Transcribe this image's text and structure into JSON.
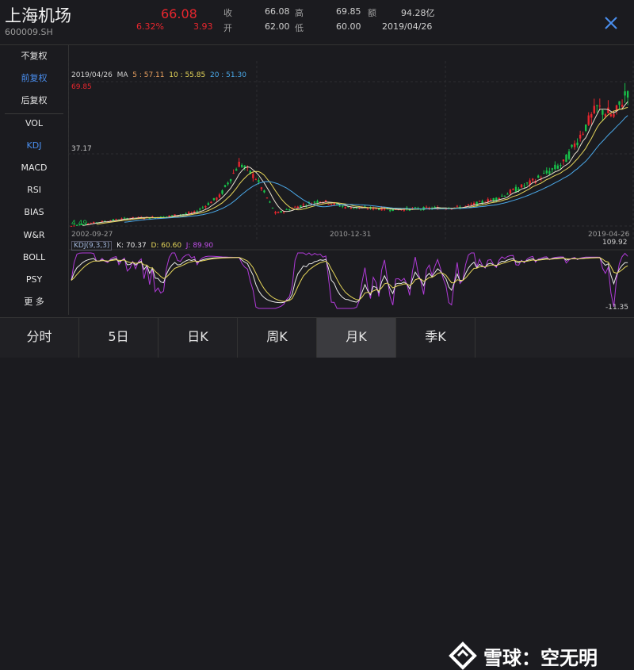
{
  "header": {
    "stock_name": "上海机场",
    "stock_code": "600009.SH",
    "price": "66.08",
    "change_pct": "6.32%",
    "change_value": "3.93",
    "quotes": [
      {
        "label": "收",
        "value": "66.08"
      },
      {
        "label": "高",
        "value": "69.85"
      },
      {
        "label": "额",
        "value": "94.28亿"
      },
      {
        "label": "开",
        "value": "62.00"
      },
      {
        "label": "低",
        "value": "60.00"
      },
      {
        "label": "date",
        "value": "2019/04/26"
      }
    ]
  },
  "sidebar": {
    "items": [
      {
        "label": "不复权",
        "active": false
      },
      {
        "label": "前复权",
        "active": true
      },
      {
        "label": "后复权",
        "active": false
      },
      {
        "label": "VOL",
        "active": false
      },
      {
        "label": "KDJ",
        "active": true
      },
      {
        "label": "MACD",
        "active": false
      },
      {
        "label": "RSI",
        "active": false
      },
      {
        "label": "BIAS",
        "active": false
      },
      {
        "label": "W&R",
        "active": false
      },
      {
        "label": "BOLL",
        "active": false
      },
      {
        "label": "PSY",
        "active": false
      },
      {
        "label": "更 多",
        "active": false
      }
    ]
  },
  "chart": {
    "ma_date": "2019/04/26",
    "ma_label": "MA",
    "ma5_label": "5 : 57.11",
    "ma10_label": "10 : 55.85",
    "ma20_label": "20 : 51.30",
    "y_max_label": "69.85",
    "y_mid_label": "37.17",
    "y_min_label": "4.49",
    "x_start": "2002-09-27",
    "x_mid": "2010-12-31",
    "x_end": "2019-04-26",
    "kdj_title": "KDJ(9,3,3)",
    "kdj_k": "K: 70.37",
    "kdj_d": "D: 60.60",
    "kdj_j": "J: 89.90",
    "kdj_max": "109.92",
    "kdj_min": "-11.35",
    "colors": {
      "up": "#e8262e",
      "down": "#18c24a",
      "ma5": "#e8e0d0",
      "ma10": "#e6d65a",
      "ma20": "#4aa8e8",
      "k": "#e8e8e8",
      "d": "#e6d65a",
      "j": "#b03ad8",
      "accent": "#4a8ff0"
    }
  },
  "chart_data": {
    "type": "candlestick",
    "title": "",
    "x_range": [
      "2002-09-27",
      "2019-04-26"
    ],
    "y_range": [
      4.49,
      69.85
    ],
    "series": [
      {
        "name": "MA5",
        "last": 57.11
      },
      {
        "name": "MA10",
        "last": 55.85
      },
      {
        "name": "MA20",
        "last": 51.3
      }
    ],
    "price_anchors": [
      {
        "x": "2002-09-27",
        "y": 4.49
      },
      {
        "x": "2003-06",
        "y": 6.0
      },
      {
        "x": "2004-06",
        "y": 8.0
      },
      {
        "x": "2005-06",
        "y": 8.5
      },
      {
        "x": "2006-06",
        "y": 10.5
      },
      {
        "x": "2007-03",
        "y": 18.0
      },
      {
        "x": "2007-10",
        "y": 33.0
      },
      {
        "x": "2008-04",
        "y": 26.0
      },
      {
        "x": "2008-11",
        "y": 10.0
      },
      {
        "x": "2009-06",
        "y": 13.0
      },
      {
        "x": "2010-03",
        "y": 16.0
      },
      {
        "x": "2010-12",
        "y": 13.0
      },
      {
        "x": "2012-06",
        "y": 12.0
      },
      {
        "x": "2014-06",
        "y": 13.0
      },
      {
        "x": "2015-06",
        "y": 17.0
      },
      {
        "x": "2016-06",
        "y": 24.0
      },
      {
        "x": "2017-06",
        "y": 33.0
      },
      {
        "x": "2018-01",
        "y": 48.0
      },
      {
        "x": "2018-06",
        "y": 58.0
      },
      {
        "x": "2018-12",
        "y": 54.0
      },
      {
        "x": "2019-04-26",
        "y": 66.08
      }
    ],
    "kdj": {
      "K": 70.37,
      "D": 60.6,
      "J": 89.9,
      "max": 109.92,
      "min": -11.35
    }
  },
  "tabs": [
    {
      "label": "分时",
      "active": false
    },
    {
      "label": "5日",
      "active": false
    },
    {
      "label": "日K",
      "active": false
    },
    {
      "label": "周K",
      "active": false
    },
    {
      "label": "月K",
      "active": true
    },
    {
      "label": "季K",
      "active": false
    }
  ],
  "watermark": {
    "text": "雪球：空无明"
  }
}
